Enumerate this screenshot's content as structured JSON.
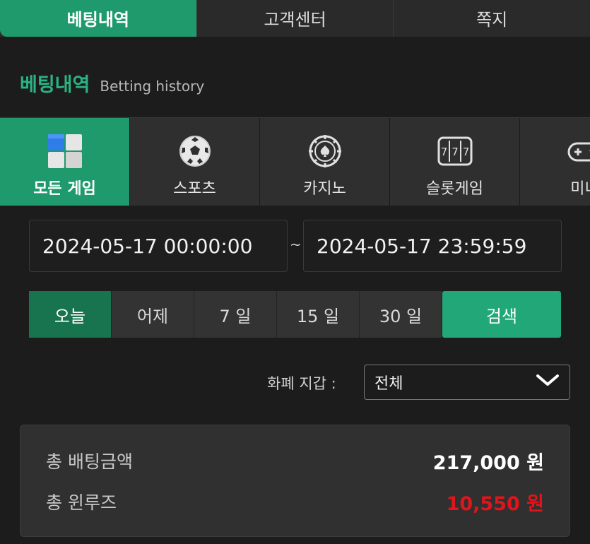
{
  "top_tabs": [
    {
      "label": "베팅내역"
    },
    {
      "label": "고객센터"
    },
    {
      "label": "쪽지"
    }
  ],
  "title": {
    "main": "베팅내역",
    "sub": "Betting history"
  },
  "game_tabs": [
    {
      "label": "모든 게임",
      "icon": "all-games-cubes-icon"
    },
    {
      "label": "스포츠",
      "icon": "soccer-ball-icon"
    },
    {
      "label": "카지노",
      "icon": "casino-chip-icon"
    },
    {
      "label": "슬롯게임",
      "icon": "slot-777-icon"
    },
    {
      "label": "미니",
      "icon": "gamepad-icon"
    }
  ],
  "date_range": {
    "start": "2024-05-17 00:00:00",
    "separator": "~",
    "end": "2024-05-17 23:59:59"
  },
  "quick_ranges": [
    "오늘",
    "어제",
    "7 일",
    "15 일",
    "30 일"
  ],
  "search_label": "검색",
  "currency": {
    "label": "화폐 지갑 :",
    "selected": "전체"
  },
  "summary": {
    "total_bet_label": "총 배팅금액",
    "total_bet_value": "217,000 원",
    "total_winloss_label": "총 윈루즈",
    "total_winloss_value": "10,550 원"
  },
  "colors": {
    "accent": "#1f9a6c",
    "loss_red": "#e0151c"
  }
}
